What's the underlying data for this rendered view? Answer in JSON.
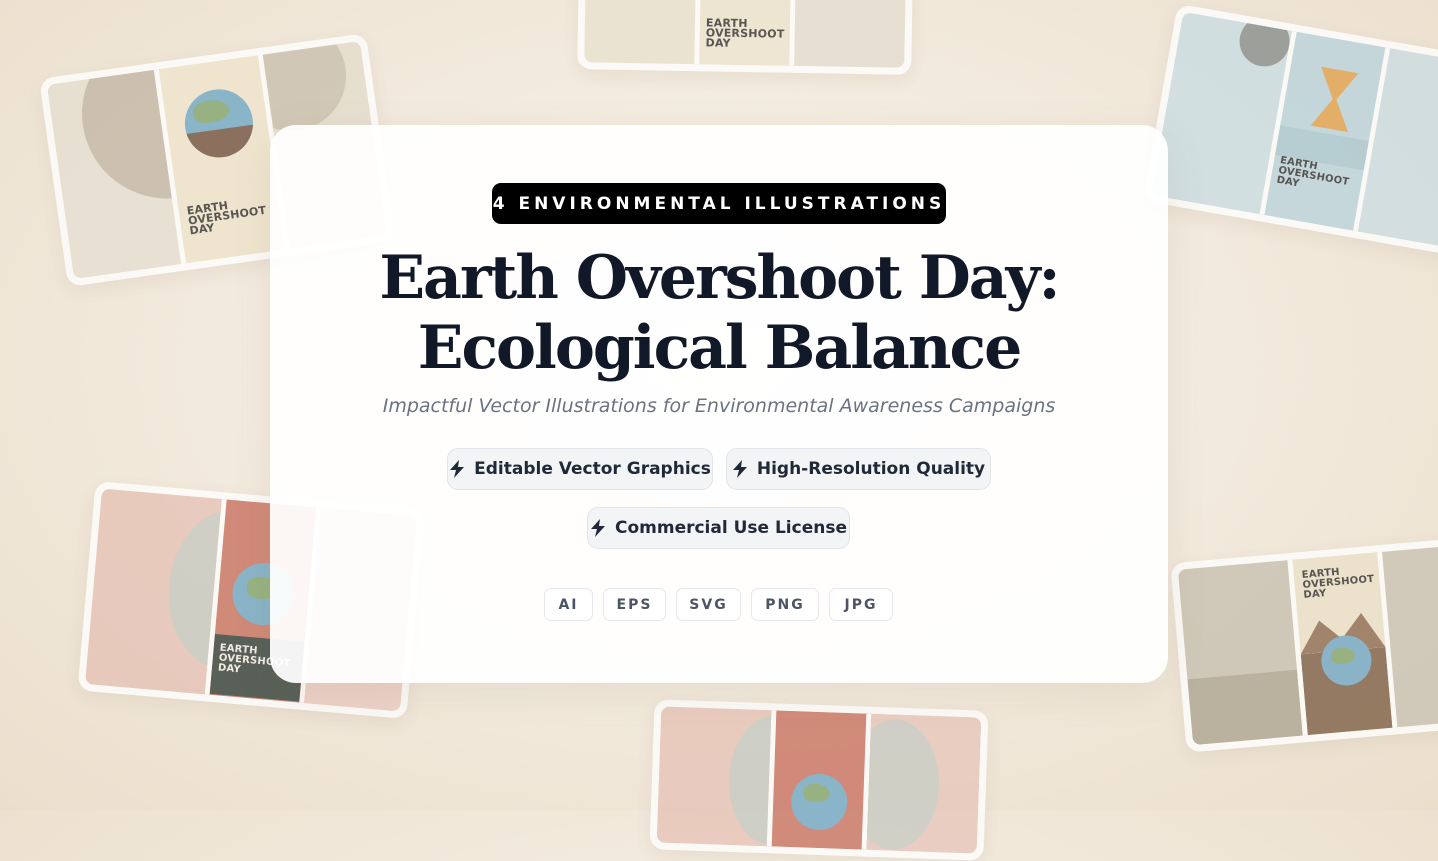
{
  "badge": "4 ENVIRONMENTAL ILLUSTRATIONS",
  "title_line1": "Earth Overshoot Day:",
  "title_line2": "Ecological Balance",
  "subtitle": "Impactful Vector Illustrations for Environmental Awareness Campaigns",
  "features": [
    {
      "label": "Editable Vector Graphics",
      "icon": "lightning-bolt-icon"
    },
    {
      "label": "High-Resolution Quality",
      "icon": "lightning-bolt-icon"
    },
    {
      "label": "Commercial Use License",
      "icon": "lightning-bolt-icon"
    }
  ],
  "formats": [
    "AI",
    "EPS",
    "SVG",
    "PNG",
    "JPG"
  ],
  "poster_text": {
    "line1": "EARTH",
    "line2": "OVERSHOOT",
    "line3": "DAY",
    "combined": "OVERSHOOT DAY"
  },
  "colors": {
    "badge_bg": "#000000",
    "title": "#111827",
    "subtitle": "#6b7280",
    "poster_sand": "#ece3cf",
    "poster_blue": "#c9dde3",
    "poster_red": "#c9705f",
    "poster_brown": "#8a6a4f"
  }
}
